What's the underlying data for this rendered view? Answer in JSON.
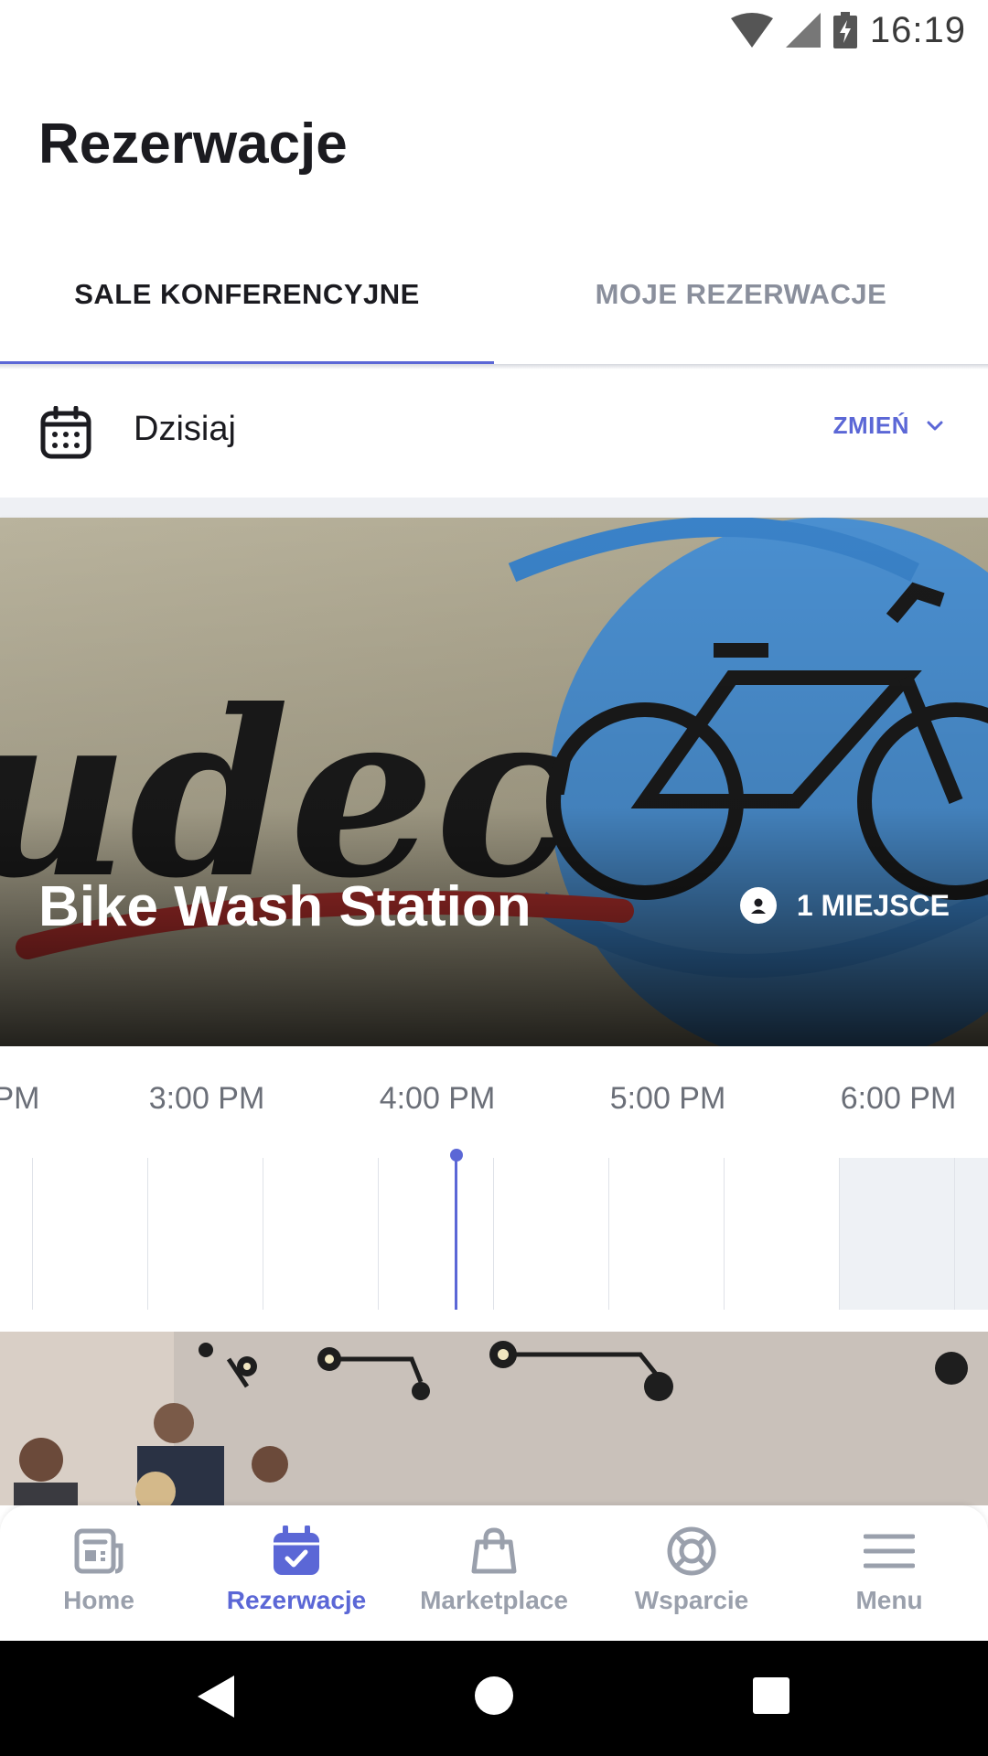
{
  "status_bar": {
    "time": "16:19"
  },
  "header": {
    "title": "Rezerwacje"
  },
  "tabs": [
    {
      "label": "SALE KONFERENCYJNE",
      "active": true
    },
    {
      "label": "MOJE REZERWACJE",
      "active": false
    }
  ],
  "date_selector": {
    "label": "Dzisiaj",
    "change_label": "ZMIEŃ",
    "icon": "calendar-icon"
  },
  "room_card": {
    "name": "Bike Wash Station",
    "capacity": "1 MIEJSCE",
    "capacity_icon": "person-icon",
    "timeline": {
      "labels": [
        "PM",
        "3:00 PM",
        "4:00 PM",
        "5:00 PM",
        "6:00 PM"
      ]
    }
  },
  "bottom_nav": {
    "items": [
      {
        "label": "Home",
        "icon": "news-icon",
        "active": false
      },
      {
        "label": "Rezerwacje",
        "icon": "calendar-check-icon",
        "active": true
      },
      {
        "label": "Marketplace",
        "icon": "shopping-bag-icon",
        "active": false
      },
      {
        "label": "Wsparcie",
        "icon": "lifebuoy-icon",
        "active": false
      },
      {
        "label": "Menu",
        "icon": "menu-icon",
        "active": false
      }
    ]
  },
  "colors": {
    "accent": "#5b67d6",
    "text": "#1b1b20",
    "muted": "#8a8f9c"
  }
}
